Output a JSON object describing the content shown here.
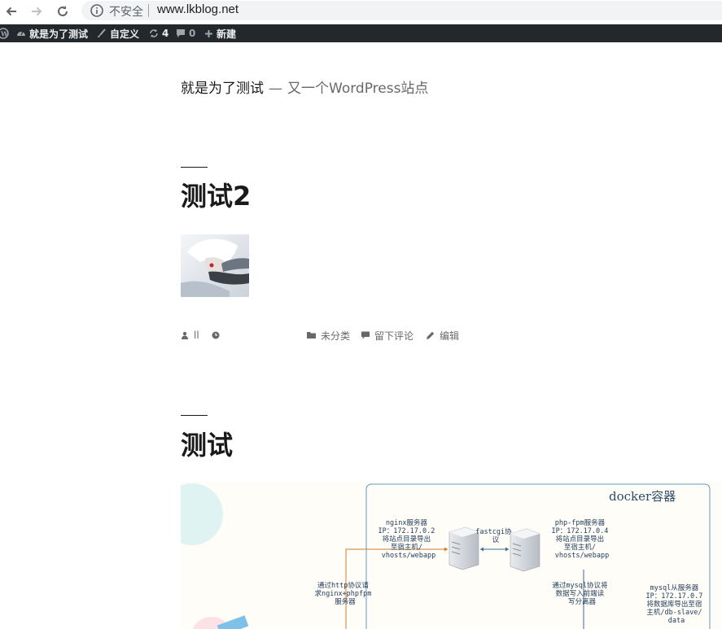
{
  "browser": {
    "security_label": "不安全",
    "url": "www.lkblog.net"
  },
  "admin_bar": {
    "site_name": "就是为了测试",
    "customize_label": "自定义",
    "updates_count": "4",
    "comments_count": "0",
    "new_label": "新建"
  },
  "site": {
    "title": "就是为了测试",
    "separator": "—",
    "description": "又一个WordPress站点"
  },
  "posts": [
    {
      "title": "测试2",
      "meta": {
        "author": "ll",
        "category": "未分类",
        "comment_link": "留下评论",
        "edit_link": "编辑"
      }
    },
    {
      "title": "测试",
      "diagram": {
        "container_label": "docker容器",
        "nginx_text": [
          "nginx服务器",
          "IP：172.17.0.2",
          "将站点目录导出",
          "至宿主机/",
          "vhosts/webapp"
        ],
        "fastcgi_text": [
          "fastcgi协",
          "议"
        ],
        "phpfpm_text": [
          "php-fpm服务器",
          "IP：172.17.0.4",
          "将站点目录导出",
          "至宿主机/",
          "vhosts/webapp"
        ],
        "http_text": [
          "通过http协议请",
          "求nginx+phpfpm",
          "服务器"
        ],
        "mysql_proto_text": [
          "通过mysql协议将",
          "数据写入前端读",
          "写分离器"
        ],
        "mysql_slave_text": [
          "mysql从服务器",
          "IP：172.17.0.7",
          "将数据库导出至宿",
          "主机/db-slave/",
          "data"
        ]
      }
    }
  ],
  "colors": {
    "admin_bar_bg": "#23282d",
    "title_color": "#1a1a1a",
    "meta_color": "#686868",
    "diagram_border": "#5b9bc2"
  }
}
